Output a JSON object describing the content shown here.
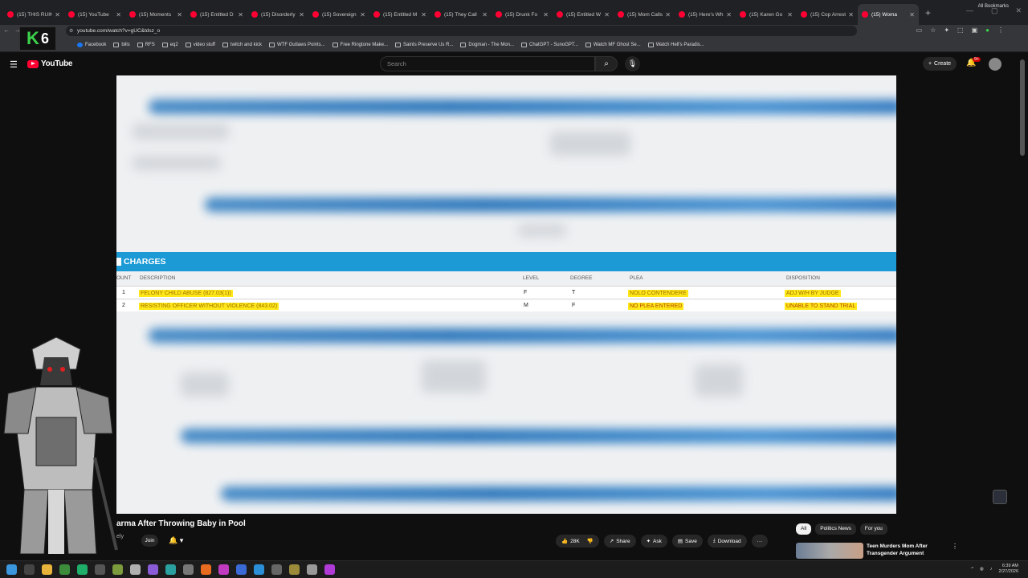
{
  "browser": {
    "tabs": [
      {
        "title": "(15) THIS RUIN",
        "active": false
      },
      {
        "title": "(15) YouTube",
        "active": false
      },
      {
        "title": "(15) Moments",
        "active": false
      },
      {
        "title": "(15) Entitled D",
        "active": false
      },
      {
        "title": "(15) Disorderly",
        "active": false
      },
      {
        "title": "(15) Sovereign",
        "active": false
      },
      {
        "title": "(15) Entitled M",
        "active": false
      },
      {
        "title": "(15) They Call",
        "active": false
      },
      {
        "title": "(15) Drunk Fo",
        "active": false
      },
      {
        "title": "(15) Entitled W",
        "active": false
      },
      {
        "title": "(15) Mom Calls",
        "active": false
      },
      {
        "title": "(15) Here's Wh",
        "active": false
      },
      {
        "title": "(15) Karen Go",
        "active": false
      },
      {
        "title": "(15) Cop Arrest",
        "active": false
      },
      {
        "title": "(15) Woma",
        "active": true
      }
    ],
    "new_tab": "+",
    "url": "youtube.com/watch?v=gUC&tdsz_o",
    "bookmarks": [
      {
        "label": "Facebook",
        "icon": "facebook-icon"
      },
      {
        "label": "bills",
        "icon": "folder-icon"
      },
      {
        "label": "RFS",
        "icon": "folder-icon"
      },
      {
        "label": "eq2",
        "icon": "folder-icon"
      },
      {
        "label": "video stuff",
        "icon": "folder-icon"
      },
      {
        "label": "twitch and kick",
        "icon": "folder-icon"
      },
      {
        "label": "WTF Outlaws Points...",
        "icon": "page-icon"
      },
      {
        "label": "Free Ringtone Make...",
        "icon": "page-icon"
      },
      {
        "label": "Saints Preserve Us R...",
        "icon": "page-icon"
      },
      {
        "label": "Dogman - The Mon...",
        "icon": "page-icon"
      },
      {
        "label": "ChatGPT - SunoGPT...",
        "icon": "page-icon"
      },
      {
        "label": "Watch MF Ghost Se...",
        "icon": "page-icon"
      },
      {
        "label": "Watch Hell's Paradis...",
        "icon": "page-icon"
      }
    ],
    "all_bookmarks": "All Bookmarks"
  },
  "overlay": {
    "logo_k": "K",
    "logo_six": "6"
  },
  "youtube": {
    "logo": "YouTube",
    "search_placeholder": "Search",
    "create_label": "Create",
    "notifications_badge": "9+"
  },
  "video": {
    "section_title": "CHARGES",
    "columns": {
      "count": "OUNT",
      "description": "DESCRIPTION",
      "level": "LEVEL",
      "degree": "DEGREE",
      "plea": "PLEA",
      "disposition": "DISPOSITION"
    },
    "rows": [
      {
        "count": "1",
        "description": "FELONY CHILD ABUSE (827.03(1))",
        "level": "F",
        "degree": "T",
        "plea": "NOLO CONTENDERE",
        "disposition": "ADJ W/H BY JUDGE"
      },
      {
        "count": "2",
        "description": "RESISTING OFFICER WITHOUT VIOLENCE (843.02)",
        "level": "M",
        "degree": "F",
        "plea": "NO PLEA ENTERED",
        "disposition": "UNABLE TO STAND TRIAL"
      }
    ]
  },
  "below": {
    "title": "arma After Throwing Baby in Pool",
    "channel": "ely",
    "join": "Join",
    "likes": "28K",
    "share": "Share",
    "ask": "Ask",
    "save": "Save",
    "download": "Download",
    "more": "···"
  },
  "sidebar": {
    "chips": [
      "All",
      "Politics News",
      "For you"
    ],
    "recommended_title": "Teen Murders Mom After Transgender Argument"
  },
  "taskbar": {
    "time": "6:39 AM",
    "date": "2/27/2026"
  }
}
